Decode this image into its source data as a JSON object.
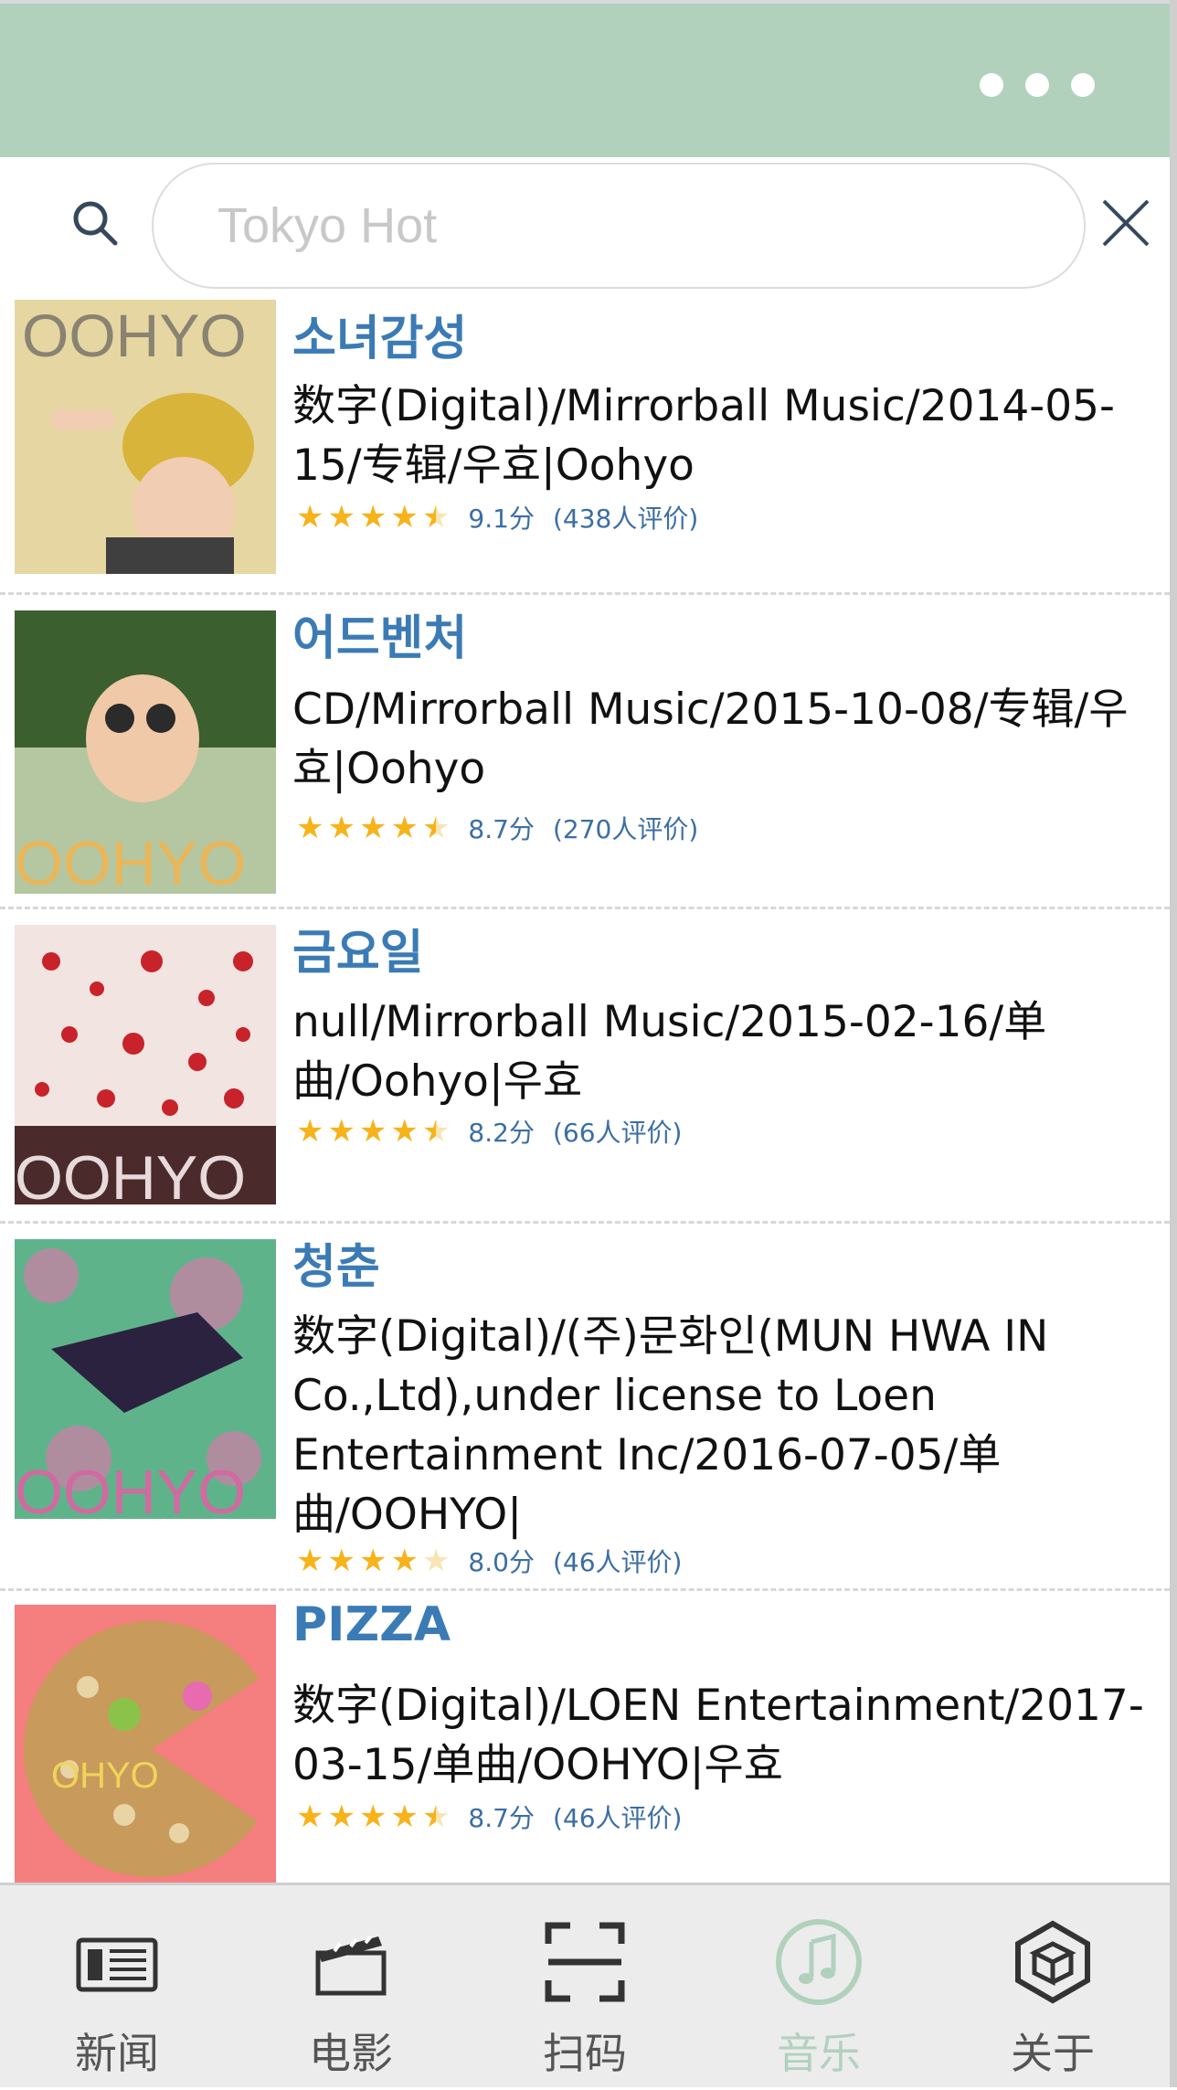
{
  "search": {
    "placeholder": "Tokyo Hot"
  },
  "albums": [
    {
      "title": "소녀감성",
      "meta": "数字(Digital)/Mirrorball Music/2014-05-15/专辑/우효|Oohyo",
      "score": "9.1分",
      "count": "(438人评价)",
      "cover_text": "OOHYO",
      "stars": 4.5
    },
    {
      "title": "어드벤처",
      "meta": "CD/Mirrorball Music/2015-10-08/专辑/우효|Oohyo",
      "score": "8.7分",
      "count": "(270人评价)",
      "cover_text": "OOHYO",
      "stars": 4.5
    },
    {
      "title": "금요일",
      "meta": "null/Mirrorball Music/2015-02-16/单曲/Oohyo|우효",
      "score": "8.2分",
      "count": "(66人评价)",
      "cover_text": "OOHYO",
      "stars": 4.5
    },
    {
      "title": "청춘",
      "meta": "数字(Digital)/(주)문화인(MUN HWA IN Co.,Ltd),under license to Loen Entertainment Inc/2016-07-05/单曲/OOHYO|",
      "score": "8.0分",
      "count": "(46人评价)",
      "cover_text": "OOHYO",
      "stars": 4
    },
    {
      "title": "PIZZA",
      "meta": "数字(Digital)/LOEN Entertainment/2017-03-15/单曲/OOHYO|우효",
      "score": "8.7分",
      "count": "(46人评价)",
      "cover_text": "OHYO",
      "stars": 4.5
    }
  ],
  "tabs": [
    {
      "label": "新闻",
      "icon": "newspaper-icon"
    },
    {
      "label": "电影",
      "icon": "clapperboard-icon"
    },
    {
      "label": "扫码",
      "icon": "scan-icon"
    },
    {
      "label": "音乐",
      "icon": "music-icon",
      "active": true
    },
    {
      "label": "关于",
      "icon": "cube-icon"
    }
  ],
  "colors": {
    "header": "#b1d1bd",
    "title": "#3b7bb5",
    "star": "#f6b31a",
    "active_tab": "#b1d1bd"
  }
}
